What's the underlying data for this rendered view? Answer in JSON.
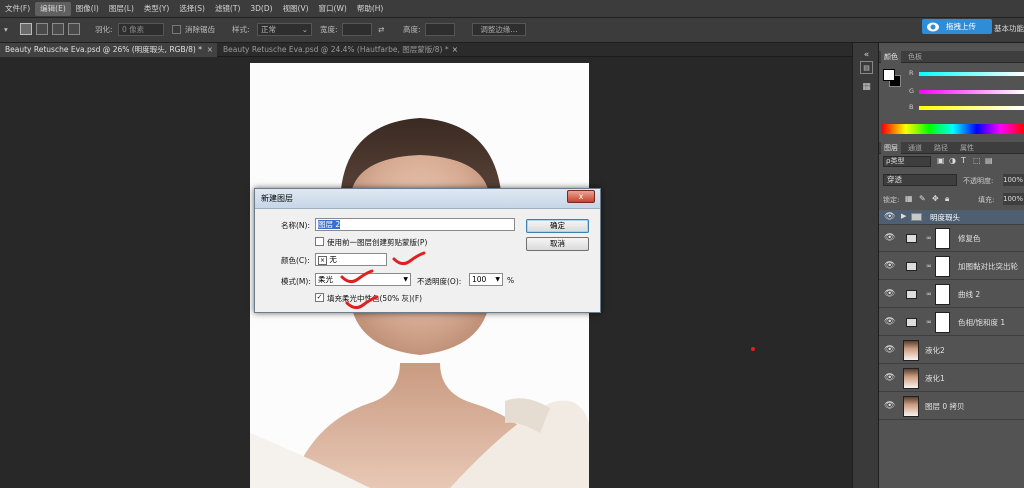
{
  "menu": {
    "items": [
      "文件(F)",
      "编辑(E)",
      "图像(I)",
      "图层(L)",
      "类型(Y)",
      "选择(S)",
      "滤镜(T)",
      "3D(D)",
      "视图(V)",
      "窗口(W)",
      "帮助(H)"
    ],
    "active_index": 1
  },
  "options": {
    "feather_label": "羽化:",
    "feather_value": "0 像素",
    "antialias_label": "消除锯齿",
    "style_label": "样式:",
    "style_value": "正常",
    "width_label": "宽度:",
    "height_label": "高度:",
    "refine_edge": "调整边缘..."
  },
  "upload": {
    "label": "拖拽上传"
  },
  "workspace_label": "基本功能",
  "tabs": [
    {
      "label": "Beauty Retusche Eva.psd @ 26% (明度瑕头, RGB/8) *",
      "close": "×"
    },
    {
      "label": "Beauty Retusche Eva.psd @ 24.4% (Hautfarbe, 图层蒙版/8) *",
      "close": "×"
    }
  ],
  "dialog": {
    "title": "新建图层",
    "close": "x",
    "name_label": "名称(N):",
    "name_value": "图层 2",
    "clip_checkbox_label": "使用前一图层创建剪贴蒙版(P)",
    "color_label": "颜色(C):",
    "color_mark": "×",
    "color_value": "无",
    "mode_label": "模式(M):",
    "mode_value": "柔光",
    "opacity_label": "不透明度(O):",
    "opacity_value": "100",
    "opacity_unit": "%",
    "fill_checkbox_mark": "✓",
    "fill_checkbox_label": "填充柔光中性色(50% 灰)(F)",
    "ok_label": "确定",
    "cancel_label": "取消"
  },
  "color_panel": {
    "tabs": [
      "颜色",
      "色板"
    ],
    "channels": [
      "R",
      "G",
      "B"
    ]
  },
  "layers_panel": {
    "tabs": [
      "图层",
      "通道",
      "路径",
      "属性"
    ],
    "filter_label": "ρ类型",
    "blend_mode": "穿透",
    "opacity_label": "不透明度:",
    "opacity_value": "100%",
    "lock_label": "锁定:",
    "fill_label": "填充:",
    "fill_value": "100%",
    "layers": [
      {
        "name": "明度瑕头",
        "type": "group"
      },
      {
        "name": "修复色",
        "type": "adjustment",
        "icon": "hue-saturation-icon"
      },
      {
        "name": "加图黏对比突出轮",
        "type": "adjustment",
        "icon": "levels-icon"
      },
      {
        "name": "曲线 2",
        "type": "adjustment",
        "icon": "curves-icon"
      },
      {
        "name": "色相/饱和度 1",
        "type": "adjustment",
        "icon": "hue-saturation-icon"
      },
      {
        "name": "液化2",
        "type": "image"
      },
      {
        "name": "液化1",
        "type": "image"
      },
      {
        "name": "图层 0 拷贝",
        "type": "image"
      }
    ]
  },
  "colors": {
    "accent": "#2f8dd8",
    "highlight": "#3a6fd0",
    "annotation": "#e02020"
  }
}
